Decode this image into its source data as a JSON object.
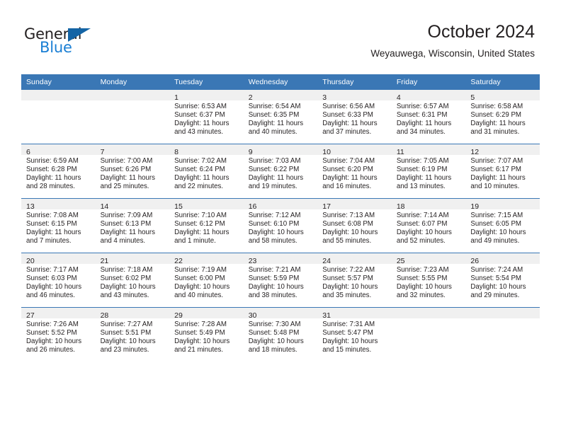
{
  "logo": {
    "word_top": "General",
    "word_bottom": "Blue",
    "accent_color": "#1464a5",
    "blue_text_color": "#1a7fd4",
    "triangle_icon": "triangle-icon"
  },
  "header": {
    "title": "October 2024",
    "subtitle": "Weyauwega, Wisconsin, United States"
  },
  "theme": {
    "header_blue": "#3a77b5",
    "day_band_gray": "#f0f0f0",
    "text_color": "#231f20"
  },
  "calendar": {
    "weekdays": [
      "Sunday",
      "Monday",
      "Tuesday",
      "Wednesday",
      "Thursday",
      "Friday",
      "Saturday"
    ],
    "weeks": [
      [
        {
          "day": "",
          "sunrise": "",
          "sunset": "",
          "daylight_line1": "",
          "daylight_line2": "",
          "empty": true
        },
        {
          "day": "",
          "sunrise": "",
          "sunset": "",
          "daylight_line1": "",
          "daylight_line2": "",
          "empty": true
        },
        {
          "day": "1",
          "sunrise": "Sunrise: 6:53 AM",
          "sunset": "Sunset: 6:37 PM",
          "daylight_line1": "Daylight: 11 hours",
          "daylight_line2": "and 43 minutes."
        },
        {
          "day": "2",
          "sunrise": "Sunrise: 6:54 AM",
          "sunset": "Sunset: 6:35 PM",
          "daylight_line1": "Daylight: 11 hours",
          "daylight_line2": "and 40 minutes."
        },
        {
          "day": "3",
          "sunrise": "Sunrise: 6:56 AM",
          "sunset": "Sunset: 6:33 PM",
          "daylight_line1": "Daylight: 11 hours",
          "daylight_line2": "and 37 minutes."
        },
        {
          "day": "4",
          "sunrise": "Sunrise: 6:57 AM",
          "sunset": "Sunset: 6:31 PM",
          "daylight_line1": "Daylight: 11 hours",
          "daylight_line2": "and 34 minutes."
        },
        {
          "day": "5",
          "sunrise": "Sunrise: 6:58 AM",
          "sunset": "Sunset: 6:29 PM",
          "daylight_line1": "Daylight: 11 hours",
          "daylight_line2": "and 31 minutes."
        }
      ],
      [
        {
          "day": "6",
          "sunrise": "Sunrise: 6:59 AM",
          "sunset": "Sunset: 6:28 PM",
          "daylight_line1": "Daylight: 11 hours",
          "daylight_line2": "and 28 minutes."
        },
        {
          "day": "7",
          "sunrise": "Sunrise: 7:00 AM",
          "sunset": "Sunset: 6:26 PM",
          "daylight_line1": "Daylight: 11 hours",
          "daylight_line2": "and 25 minutes."
        },
        {
          "day": "8",
          "sunrise": "Sunrise: 7:02 AM",
          "sunset": "Sunset: 6:24 PM",
          "daylight_line1": "Daylight: 11 hours",
          "daylight_line2": "and 22 minutes."
        },
        {
          "day": "9",
          "sunrise": "Sunrise: 7:03 AM",
          "sunset": "Sunset: 6:22 PM",
          "daylight_line1": "Daylight: 11 hours",
          "daylight_line2": "and 19 minutes."
        },
        {
          "day": "10",
          "sunrise": "Sunrise: 7:04 AM",
          "sunset": "Sunset: 6:20 PM",
          "daylight_line1": "Daylight: 11 hours",
          "daylight_line2": "and 16 minutes."
        },
        {
          "day": "11",
          "sunrise": "Sunrise: 7:05 AM",
          "sunset": "Sunset: 6:19 PM",
          "daylight_line1": "Daylight: 11 hours",
          "daylight_line2": "and 13 minutes."
        },
        {
          "day": "12",
          "sunrise": "Sunrise: 7:07 AM",
          "sunset": "Sunset: 6:17 PM",
          "daylight_line1": "Daylight: 11 hours",
          "daylight_line2": "and 10 minutes."
        }
      ],
      [
        {
          "day": "13",
          "sunrise": "Sunrise: 7:08 AM",
          "sunset": "Sunset: 6:15 PM",
          "daylight_line1": "Daylight: 11 hours",
          "daylight_line2": "and 7 minutes."
        },
        {
          "day": "14",
          "sunrise": "Sunrise: 7:09 AM",
          "sunset": "Sunset: 6:13 PM",
          "daylight_line1": "Daylight: 11 hours",
          "daylight_line2": "and 4 minutes."
        },
        {
          "day": "15",
          "sunrise": "Sunrise: 7:10 AM",
          "sunset": "Sunset: 6:12 PM",
          "daylight_line1": "Daylight: 11 hours",
          "daylight_line2": "and 1 minute."
        },
        {
          "day": "16",
          "sunrise": "Sunrise: 7:12 AM",
          "sunset": "Sunset: 6:10 PM",
          "daylight_line1": "Daylight: 10 hours",
          "daylight_line2": "and 58 minutes."
        },
        {
          "day": "17",
          "sunrise": "Sunrise: 7:13 AM",
          "sunset": "Sunset: 6:08 PM",
          "daylight_line1": "Daylight: 10 hours",
          "daylight_line2": "and 55 minutes."
        },
        {
          "day": "18",
          "sunrise": "Sunrise: 7:14 AM",
          "sunset": "Sunset: 6:07 PM",
          "daylight_line1": "Daylight: 10 hours",
          "daylight_line2": "and 52 minutes."
        },
        {
          "day": "19",
          "sunrise": "Sunrise: 7:15 AM",
          "sunset": "Sunset: 6:05 PM",
          "daylight_line1": "Daylight: 10 hours",
          "daylight_line2": "and 49 minutes."
        }
      ],
      [
        {
          "day": "20",
          "sunrise": "Sunrise: 7:17 AM",
          "sunset": "Sunset: 6:03 PM",
          "daylight_line1": "Daylight: 10 hours",
          "daylight_line2": "and 46 minutes."
        },
        {
          "day": "21",
          "sunrise": "Sunrise: 7:18 AM",
          "sunset": "Sunset: 6:02 PM",
          "daylight_line1": "Daylight: 10 hours",
          "daylight_line2": "and 43 minutes."
        },
        {
          "day": "22",
          "sunrise": "Sunrise: 7:19 AM",
          "sunset": "Sunset: 6:00 PM",
          "daylight_line1": "Daylight: 10 hours",
          "daylight_line2": "and 40 minutes."
        },
        {
          "day": "23",
          "sunrise": "Sunrise: 7:21 AM",
          "sunset": "Sunset: 5:59 PM",
          "daylight_line1": "Daylight: 10 hours",
          "daylight_line2": "and 38 minutes."
        },
        {
          "day": "24",
          "sunrise": "Sunrise: 7:22 AM",
          "sunset": "Sunset: 5:57 PM",
          "daylight_line1": "Daylight: 10 hours",
          "daylight_line2": "and 35 minutes."
        },
        {
          "day": "25",
          "sunrise": "Sunrise: 7:23 AM",
          "sunset": "Sunset: 5:55 PM",
          "daylight_line1": "Daylight: 10 hours",
          "daylight_line2": "and 32 minutes."
        },
        {
          "day": "26",
          "sunrise": "Sunrise: 7:24 AM",
          "sunset": "Sunset: 5:54 PM",
          "daylight_line1": "Daylight: 10 hours",
          "daylight_line2": "and 29 minutes."
        }
      ],
      [
        {
          "day": "27",
          "sunrise": "Sunrise: 7:26 AM",
          "sunset": "Sunset: 5:52 PM",
          "daylight_line1": "Daylight: 10 hours",
          "daylight_line2": "and 26 minutes."
        },
        {
          "day": "28",
          "sunrise": "Sunrise: 7:27 AM",
          "sunset": "Sunset: 5:51 PM",
          "daylight_line1": "Daylight: 10 hours",
          "daylight_line2": "and 23 minutes."
        },
        {
          "day": "29",
          "sunrise": "Sunrise: 7:28 AM",
          "sunset": "Sunset: 5:49 PM",
          "daylight_line1": "Daylight: 10 hours",
          "daylight_line2": "and 21 minutes."
        },
        {
          "day": "30",
          "sunrise": "Sunrise: 7:30 AM",
          "sunset": "Sunset: 5:48 PM",
          "daylight_line1": "Daylight: 10 hours",
          "daylight_line2": "and 18 minutes."
        },
        {
          "day": "31",
          "sunrise": "Sunrise: 7:31 AM",
          "sunset": "Sunset: 5:47 PM",
          "daylight_line1": "Daylight: 10 hours",
          "daylight_line2": "and 15 minutes."
        },
        {
          "day": "",
          "sunrise": "",
          "sunset": "",
          "daylight_line1": "",
          "daylight_line2": "",
          "empty": true
        },
        {
          "day": "",
          "sunrise": "",
          "sunset": "",
          "daylight_line1": "",
          "daylight_line2": "",
          "empty": true
        }
      ]
    ]
  }
}
